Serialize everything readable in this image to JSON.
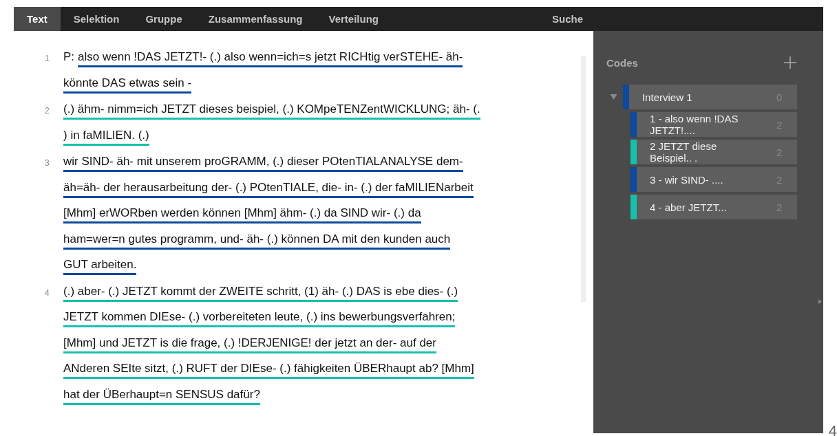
{
  "tabs": [
    {
      "label": "Text",
      "selected": true
    },
    {
      "label": "Selektion",
      "selected": false
    },
    {
      "label": "Gruppe",
      "selected": false
    },
    {
      "label": "Zusammenfassung",
      "selected": false
    },
    {
      "label": "Verteilung",
      "selected": false
    }
  ],
  "search_tab": {
    "label": "Suche",
    "selected": false
  },
  "paragraphs": [
    {
      "number": "1",
      "speaker": "P:",
      "color": "#0b4a9c",
      "lines": [
        "also wenn !DAS JETZT!- (.) also wenn=ich=s jetzt RICHtig verSTEHE- äh-",
        "könnte DAS etwas sein -"
      ]
    },
    {
      "number": "2",
      "color": "#17bfae",
      "lines": [
        "(.) ähm- nimm=ich JETZT dieses beispiel, (.) KOMpeTENZentWICKLUNG; äh- (.",
        ") in faMILIEN. (.)"
      ]
    },
    {
      "number": "3",
      "color": "#0b4a9c",
      "lines": [
        "wir SIND- äh- mit unserem proGRAMM, (.) dieser POtenTIALANALYSE dem-",
        "äh=äh- der herausarbeitung der- (.) POtenTIALE, die- in- (.) der faMILIENarbeit",
        "[Mhm] erWORben werden können [Mhm] ähm- (.) da SIND wir- (.) da",
        "ham=wer=n gutes programm, und- äh- (.) können DA mit den kunden auch",
        "GUT arbeiten."
      ]
    },
    {
      "number": "4",
      "color": "#17bfae",
      "lines": [
        "(.) aber- (.) JETZT kommt der ZWEITE schritt, (1) äh- (.) DAS is ebe dies- (.)",
        "JETZT kommen DIEse- (.) vorbereiteten leute, (.) ins bewerbungsverfahren;",
        "[Mhm] und JETZT is die frage, (.) !DERJENIGE! der jetzt an der- auf der",
        "ANderen SEIte sitzt, (.) RUFT der DIEse- (.) fähigkeiten ÜBERhaupt ab? [Mhm]",
        "hat der ÜBerhaupt=n SENSUS dafür?"
      ]
    }
  ],
  "codes": {
    "title": "Codes",
    "root": {
      "label": "Interview 1",
      "count": "0",
      "color": "#0b4a9c",
      "expanded": true,
      "children": [
        {
          "label": "1 - also wenn !DAS JETZT!....",
          "count": "2",
          "color": "#0b4a9c"
        },
        {
          "label": "2 JETZT diese Beispiel.. .",
          "count": "2",
          "color": "#17bfae"
        },
        {
          "label": "3 - wir SIND- ....",
          "count": "2",
          "color": "#0b4a9c"
        },
        {
          "label": "4 - aber JETZT...",
          "count": "2",
          "color": "#17bfae"
        }
      ]
    }
  },
  "corner_mark": "4"
}
